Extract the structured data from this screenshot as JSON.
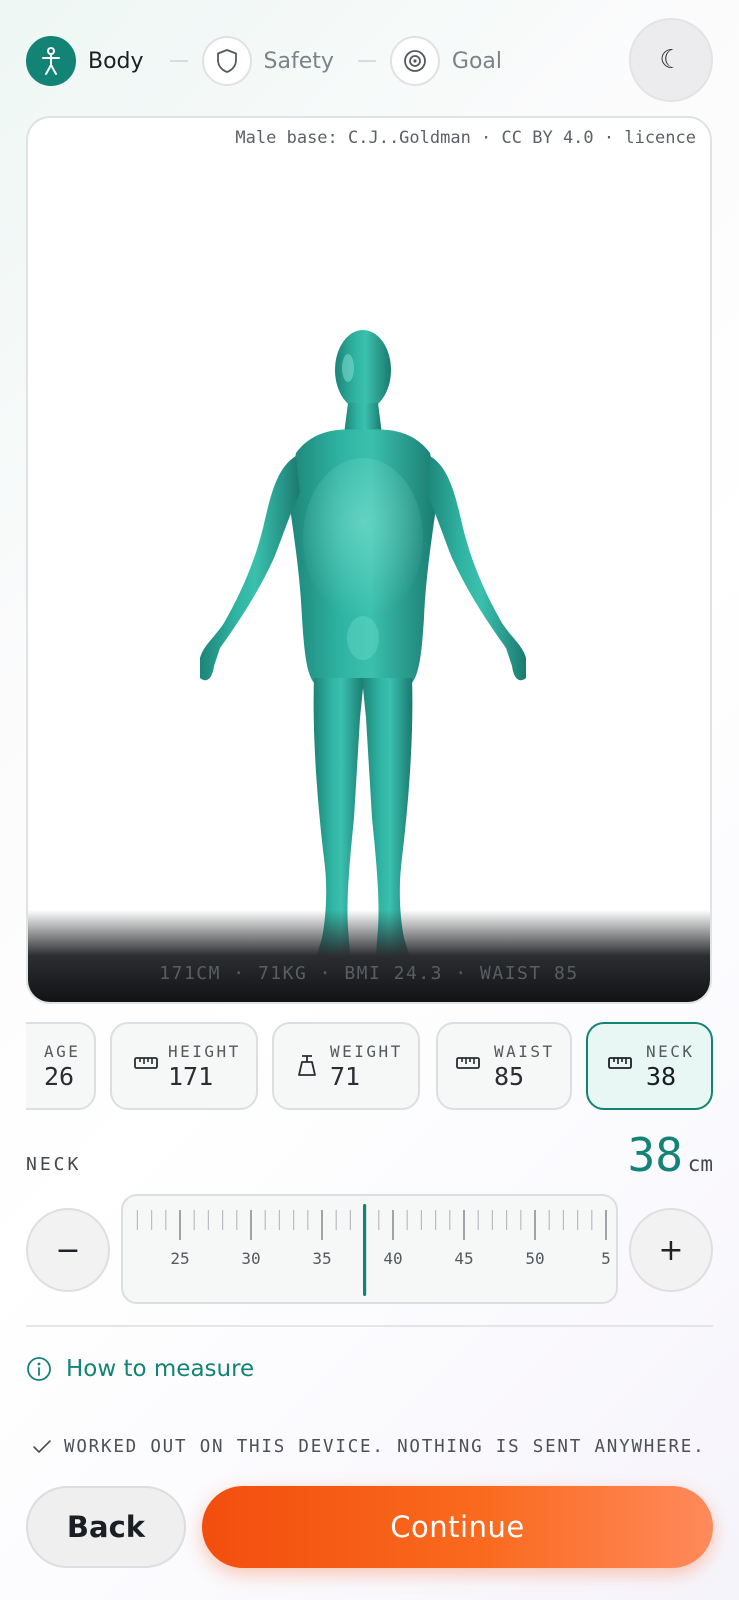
{
  "stepper": {
    "steps": [
      {
        "label": "Body",
        "icon": "person-icon",
        "active": true
      },
      {
        "label": "Safety",
        "icon": "shield-icon",
        "active": false
      },
      {
        "label": "Goal",
        "icon": "target-icon",
        "active": false
      }
    ]
  },
  "theme_toggle": {
    "icon": "moon-icon",
    "glyph": "☾"
  },
  "viewer": {
    "credit": "Male base: C.J..Goldman · CC BY 4.0 · licence",
    "stats": "171CM · 71KG · BMI 24.3 · WAIST 85",
    "model_color": "#2aa898"
  },
  "metrics": [
    {
      "label": "AGE",
      "value": "26",
      "icon": null,
      "active": false
    },
    {
      "label": "HEIGHT",
      "value": "171",
      "icon": "ruler-icon",
      "active": false
    },
    {
      "label": "WEIGHT",
      "value": "71",
      "icon": "weight-icon",
      "active": false
    },
    {
      "label": "WAIST",
      "value": "85",
      "icon": "ruler-icon",
      "active": false
    },
    {
      "label": "NECK",
      "value": "38",
      "icon": "ruler-icon",
      "active": true
    }
  ],
  "selected": {
    "label": "NECK",
    "value": "38",
    "unit": "cm"
  },
  "ruler": {
    "min": 25,
    "max": 55,
    "value": 38,
    "major_step": 5,
    "labels": [
      "25",
      "30",
      "35",
      "40",
      "45",
      "50",
      "5"
    ]
  },
  "controls": {
    "decrement": "−",
    "increment": "+"
  },
  "howto": {
    "label": "How to measure",
    "icon": "info-icon"
  },
  "privacy": {
    "text": "WORKED OUT ON THIS DEVICE. NOTHING IS SENT ANYWHERE.",
    "icon": "check-icon"
  },
  "buttons": {
    "back": "Back",
    "continue": "Continue"
  },
  "colors": {
    "accent": "#138376",
    "cta": "#f5561a"
  }
}
